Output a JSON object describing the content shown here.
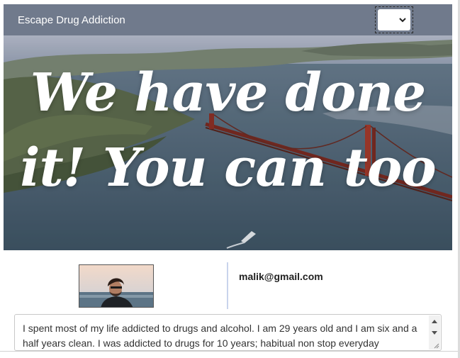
{
  "header": {
    "brand": "Escape Drug Addiction",
    "language_select": {
      "value": "",
      "icon": "chevron-down-icon"
    }
  },
  "hero": {
    "title": "We have done it! You can too",
    "image": "golden-gate-bridge-aerial"
  },
  "profile": {
    "avatar": "man-with-beard-sunglasses",
    "email": "malik@gmail.com"
  },
  "story": {
    "text": "I spent most of my life addicted to drugs and alcohol. I am 29 years old and I am six and a half years clean. I was addicted to drugs for 10 years; habitual non stop everyday"
  },
  "colors": {
    "header_bg": "#707a8c",
    "divider": "#c9d4ec"
  }
}
